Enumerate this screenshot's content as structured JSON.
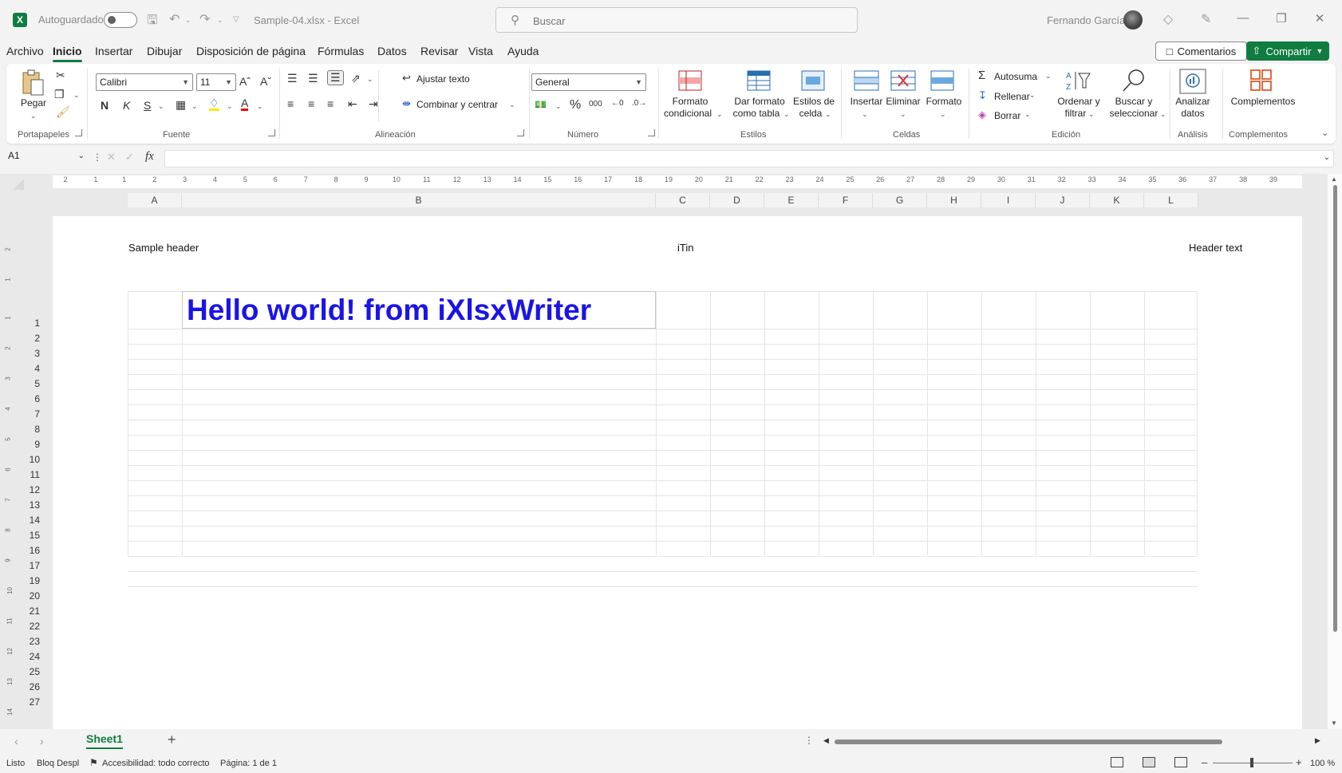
{
  "titlebar": {
    "autosave_label": "Autoguardado",
    "document_title": "Sample-04.xlsx  -  Excel",
    "search_placeholder": "Buscar",
    "user_name": "Fernando García"
  },
  "menu": {
    "tabs": [
      "Archivo",
      "Inicio",
      "Insertar",
      "Dibujar",
      "Disposición de página",
      "Fórmulas",
      "Datos",
      "Revisar",
      "Vista",
      "Ayuda"
    ],
    "active_tab": "Inicio",
    "comments_label": "Comentarios",
    "share_label": "Compartir"
  },
  "ribbon": {
    "clipboard": {
      "paste_label": "Pegar",
      "group_label": "Portapapeles"
    },
    "font": {
      "font_name": "Calibri",
      "font_size": "11",
      "bold": "N",
      "italic": "K",
      "underline": "S",
      "group_label": "Fuente"
    },
    "alignment": {
      "wrap_label": "Ajustar texto",
      "merge_label": "Combinar y centrar",
      "group_label": "Alineación"
    },
    "number": {
      "format": "General",
      "group_label": "Número"
    },
    "styles": {
      "conditional_label_1": "Formato",
      "conditional_label_2": "condicional",
      "table_label_1": "Dar formato",
      "table_label_2": "como tabla",
      "cell_styles_label_1": "Estilos de",
      "cell_styles_label_2": "celda",
      "group_label": "Estilos"
    },
    "cells": {
      "insert_label": "Insertar",
      "delete_label": "Eliminar",
      "format_label": "Formato",
      "group_label": "Celdas"
    },
    "editing": {
      "autosum_label": "Autosuma",
      "fill_label": "Rellenar",
      "clear_label": "Borrar",
      "sort_label_1": "Ordenar y",
      "sort_label_2": "filtrar",
      "find_label_1": "Buscar y",
      "find_label_2": "seleccionar",
      "group_label": "Edición"
    },
    "analysis": {
      "analyze_label_1": "Analizar",
      "analyze_label_2": "datos",
      "group_label": "Análisis"
    },
    "addins": {
      "addins_label": "Complementos",
      "group_label": "Complementos"
    }
  },
  "formula_bar": {
    "name_box": "A1",
    "fx": "fx",
    "content": ""
  },
  "sheet": {
    "columns": [
      "A",
      "B",
      "C",
      "D",
      "E",
      "F",
      "G",
      "H",
      "I",
      "J",
      "K",
      "L"
    ],
    "rows": [
      "1",
      "2",
      "3",
      "4",
      "5",
      "6",
      "7",
      "8",
      "9",
      "10",
      "11",
      "12",
      "13",
      "14",
      "15",
      "16",
      "17",
      "19",
      "20",
      "21",
      "22",
      "23",
      "24",
      "25",
      "26",
      "27"
    ],
    "ruler_h": [
      "2",
      "1",
      "1",
      "2",
      "3",
      "4",
      "5",
      "6",
      "7",
      "8",
      "9",
      "10",
      "11",
      "12",
      "13",
      "14",
      "15",
      "16",
      "17",
      "18",
      "19",
      "20",
      "21",
      "22",
      "23",
      "24",
      "25",
      "26",
      "27",
      "28",
      "29",
      "30",
      "31",
      "32",
      "33",
      "34",
      "35",
      "36",
      "37",
      "38",
      "39"
    ],
    "ruler_v": [
      "2",
      "1",
      "1",
      "2",
      "3",
      "4",
      "5",
      "6",
      "7",
      "8",
      "9",
      "10",
      "11",
      "12",
      "13",
      "14"
    ],
    "header_left": "Sample header",
    "header_center": "iTin",
    "header_right": "Header text",
    "cell_a1": "Hello world! from iXlsxWriter",
    "cell_a1_color": "#1a14e6"
  },
  "sheet_tabs": {
    "active": "Sheet1"
  },
  "statusbar": {
    "ready": "Listo",
    "scroll_lock": "Bloq Despl",
    "accessibility": "Accesibilidad: todo correcto",
    "page": "Página: 1 de 1",
    "zoom": "100 %"
  },
  "colors": {
    "accent": "#107c41",
    "cell_text": "#1a14e6"
  }
}
